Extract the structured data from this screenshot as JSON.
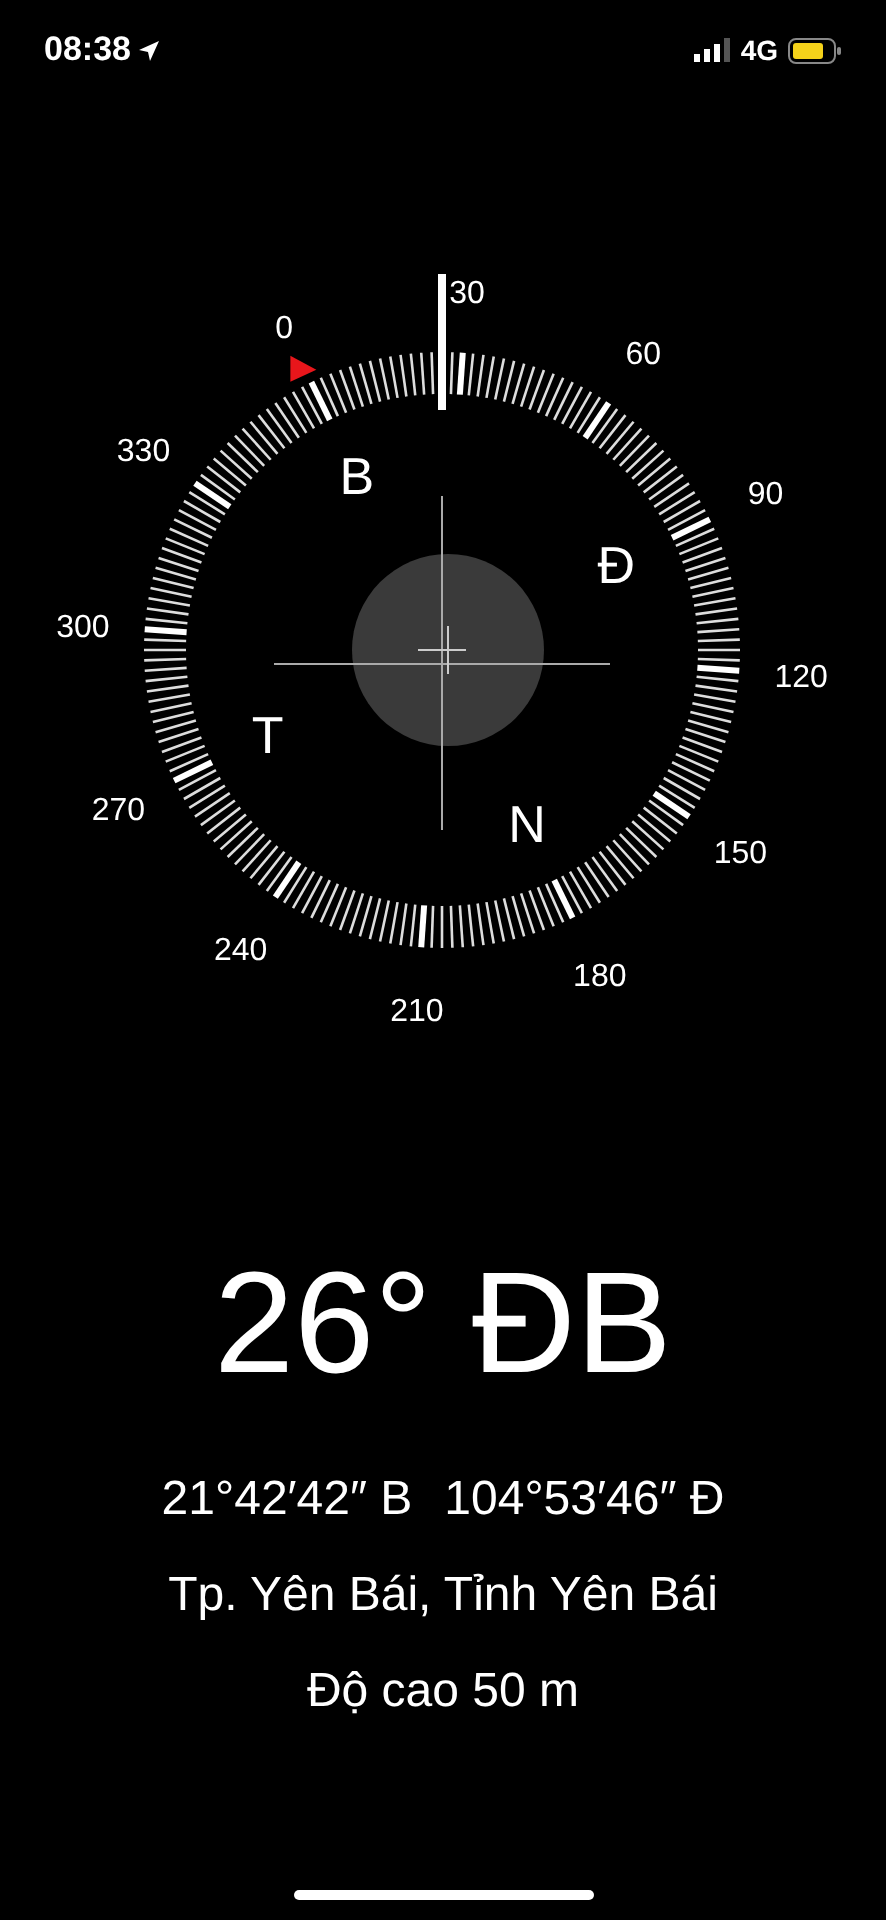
{
  "status_bar": {
    "time": "08:38",
    "network": "4G"
  },
  "compass": {
    "degree_labels": [
      "0",
      "30",
      "60",
      "90",
      "120",
      "150",
      "180",
      "210",
      "240",
      "270",
      "300",
      "330"
    ],
    "cardinal_labels": [
      "B",
      "Đ",
      "N",
      "T"
    ]
  },
  "heading": "26° ĐB",
  "coordinates": [
    "21°42′42″ B",
    "104°53′46″ Đ"
  ],
  "place": "Tp. Yên Bái, Tỉnh Yên Bái",
  "altitude": "Độ cao 50 m"
}
